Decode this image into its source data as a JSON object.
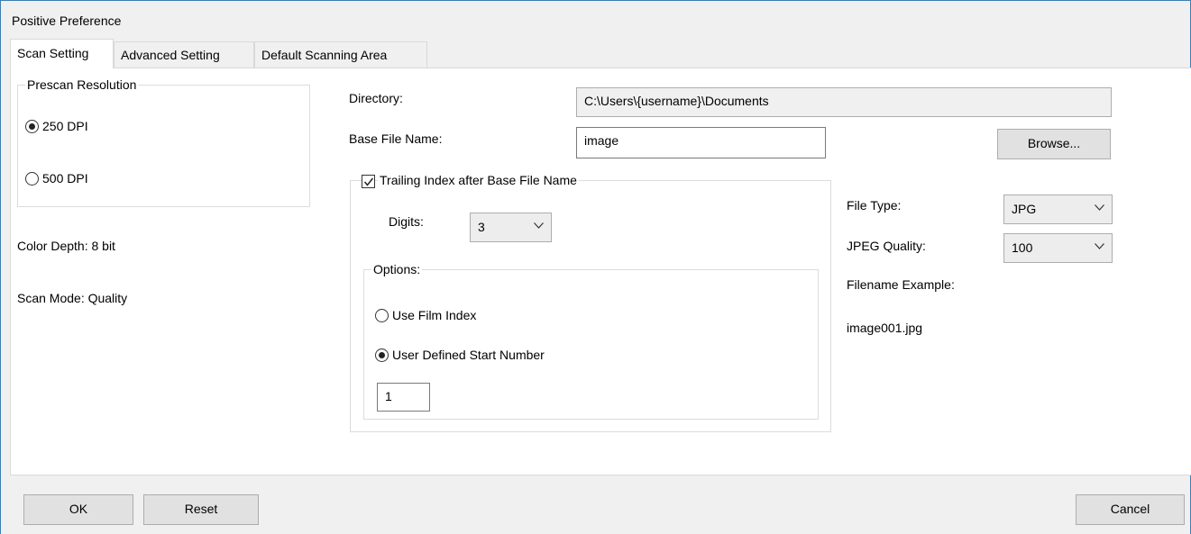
{
  "window": {
    "title": "Positive Preference"
  },
  "tabs": [
    {
      "label": "Scan Setting",
      "active": true
    },
    {
      "label": "Advanced Setting",
      "active": false
    },
    {
      "label": "Default Scanning Area",
      "active": false
    }
  ],
  "prescan": {
    "legend": "Prescan Resolution",
    "options": [
      {
        "label": "250 DPI",
        "selected": true
      },
      {
        "label": "500 DPI",
        "selected": false
      }
    ]
  },
  "info": {
    "color_depth": "Color Depth: 8 bit",
    "scan_mode": "Scan Mode: Quality"
  },
  "directory": {
    "label": "Directory:",
    "value": "C:\\Users\\{username}\\Documents"
  },
  "base_file_name": {
    "label": "Base File Name:",
    "value": "image",
    "browse_label": "Browse..."
  },
  "trailing_index": {
    "label": "Trailing Index after Base File Name",
    "checked": true,
    "digits_label": "Digits:",
    "digits_value": "3",
    "options_legend": "Options:",
    "use_film_index": "Use Film Index",
    "user_defined": "User Defined Start Number",
    "start_number": "1"
  },
  "file": {
    "type_label": "File Type:",
    "type_value": "JPG",
    "quality_label": "JPEG Quality:",
    "quality_value": "100",
    "example_label": "Filename Example:",
    "example_value": "image001.jpg"
  },
  "buttons": {
    "ok": "OK",
    "reset": "Reset",
    "cancel": "Cancel"
  },
  "icons": {
    "dropdown": "chevron-down-icon",
    "check": "checkmark-icon"
  }
}
